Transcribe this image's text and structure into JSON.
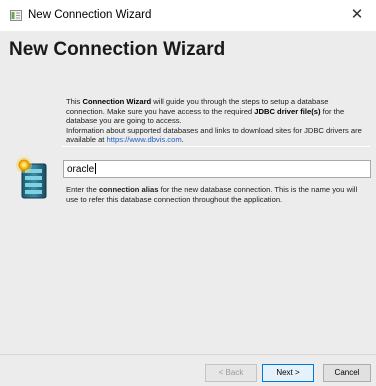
{
  "window": {
    "title": "New Connection Wizard",
    "close_glyph": "✕",
    "app_icon": "wizard-icon",
    "close_icon": "close-icon"
  },
  "header": {
    "title": "New Connection Wizard"
  },
  "intro": {
    "p1_a": "This ",
    "p1_b": "Connection Wizard",
    "p1_c": " will guide you through the steps to setup a database connection. Make sure you have access to the required ",
    "p1_d": "JDBC driver file(s)",
    "p1_e": " for the database you are going to access.",
    "p2_a": "Information about supported databases and links to download sites for JDBC drivers are available at ",
    "p2_link": "https://www.dbvis.com",
    "p2_b": "."
  },
  "alias": {
    "value": "oracle",
    "icon": "database-icon"
  },
  "help": {
    "a": "Enter the ",
    "b": "connection alias",
    "c": " for the new database connection. This is the name you will use to refer this database connection throughout the application."
  },
  "footer": {
    "back_label": "< Back",
    "next_label": "Next >",
    "cancel_label": "Cancel"
  },
  "colors": {
    "panel": "#ececec",
    "link": "#1f5fbf",
    "default_button_border": "#0078d7"
  }
}
